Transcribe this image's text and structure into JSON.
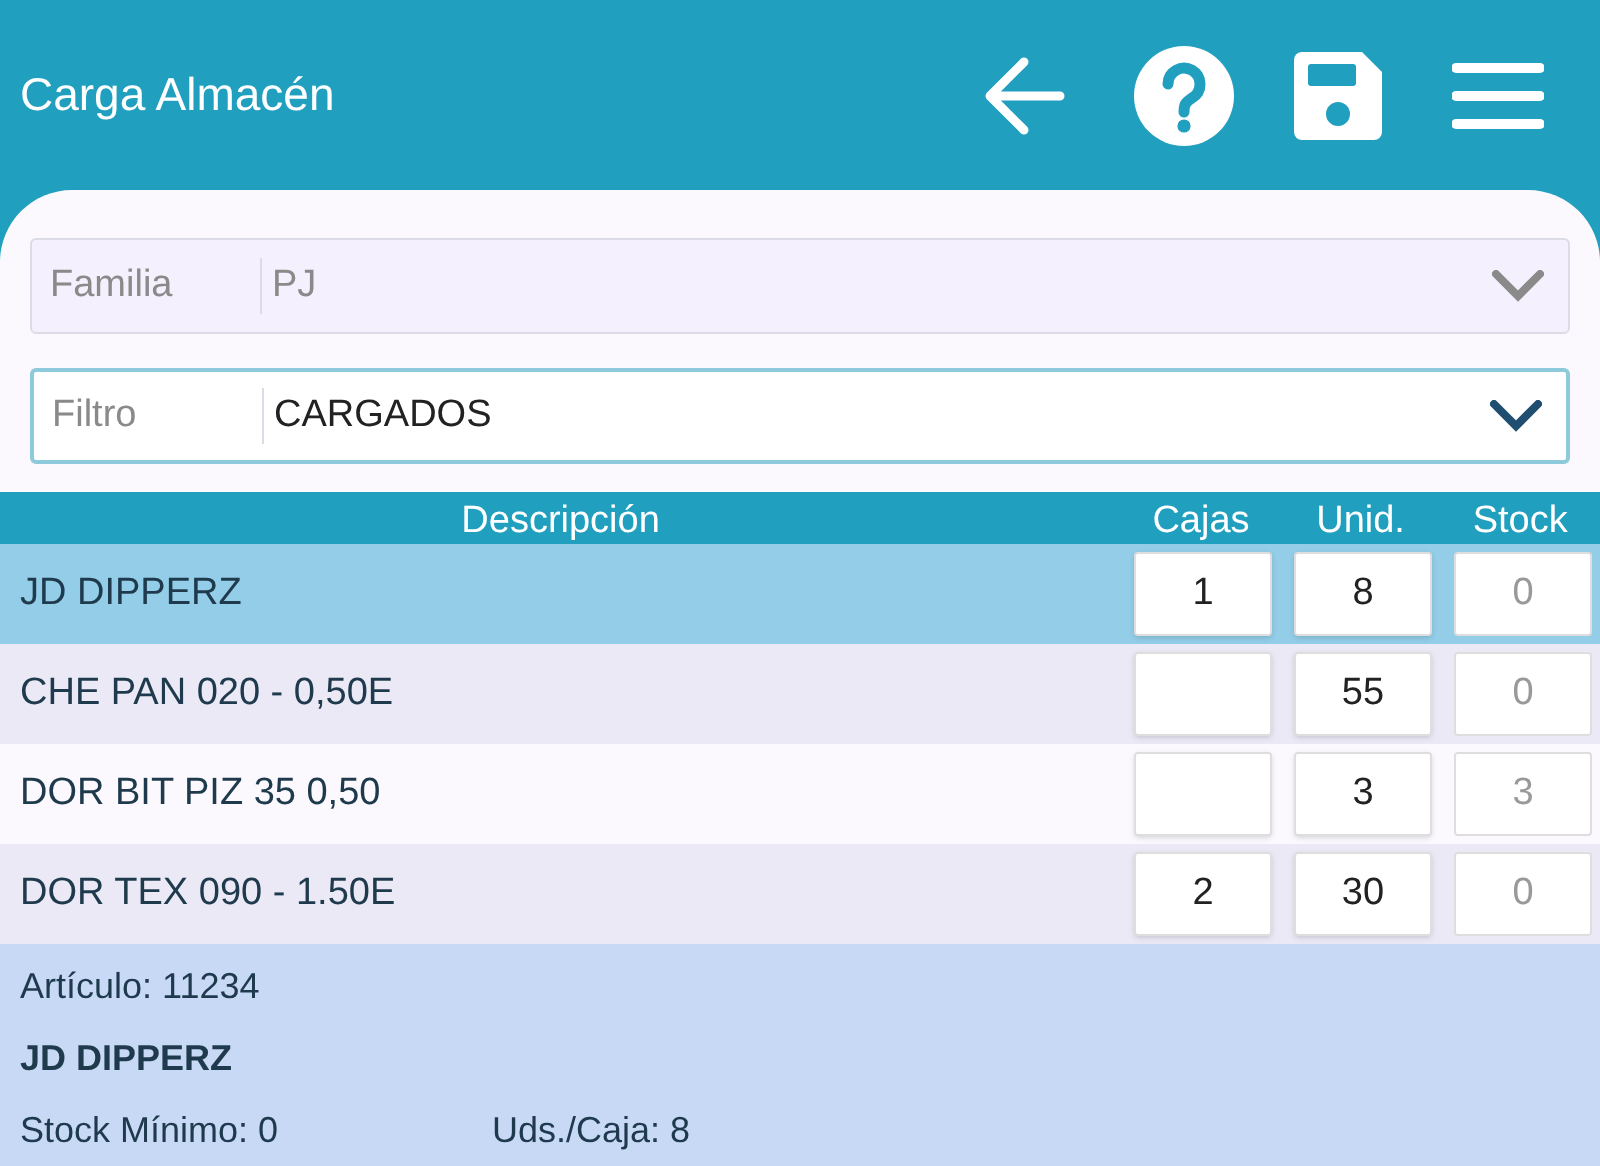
{
  "app_bar": {
    "title": "Carga Almacén"
  },
  "selects": [
    {
      "label": "Familia",
      "value": "PJ",
      "disabled": true
    },
    {
      "label": "Filtro",
      "value": "CARGADOS",
      "disabled": false
    }
  ],
  "table": {
    "columns": [
      "Descripción",
      "Cajas",
      "Unid.",
      "Stock"
    ],
    "rows": [
      {
        "description": "JD DIPPERZ",
        "cajas": "1",
        "unid": "8",
        "stock": "0",
        "selected": true
      },
      {
        "description": "CHE PAN 020 - 0,50E",
        "unid": "55",
        "stock": "0",
        "selected": false
      },
      {
        "description": "DOR BIT PIZ 35 0,50",
        "unid": "3",
        "stock": "3",
        "selected": false
      },
      {
        "description": "DOR TEX 090 - 1.50E",
        "cajas": "2",
        "unid": "30",
        "stock": "0",
        "selected": false
      }
    ]
  },
  "detail": {
    "article": "Artículo: 11234",
    "name": "JD DIPPERZ",
    "min_stock": "Stock Mínimo: 0",
    "units_per_box": "Uds./Caja: 8"
  }
}
